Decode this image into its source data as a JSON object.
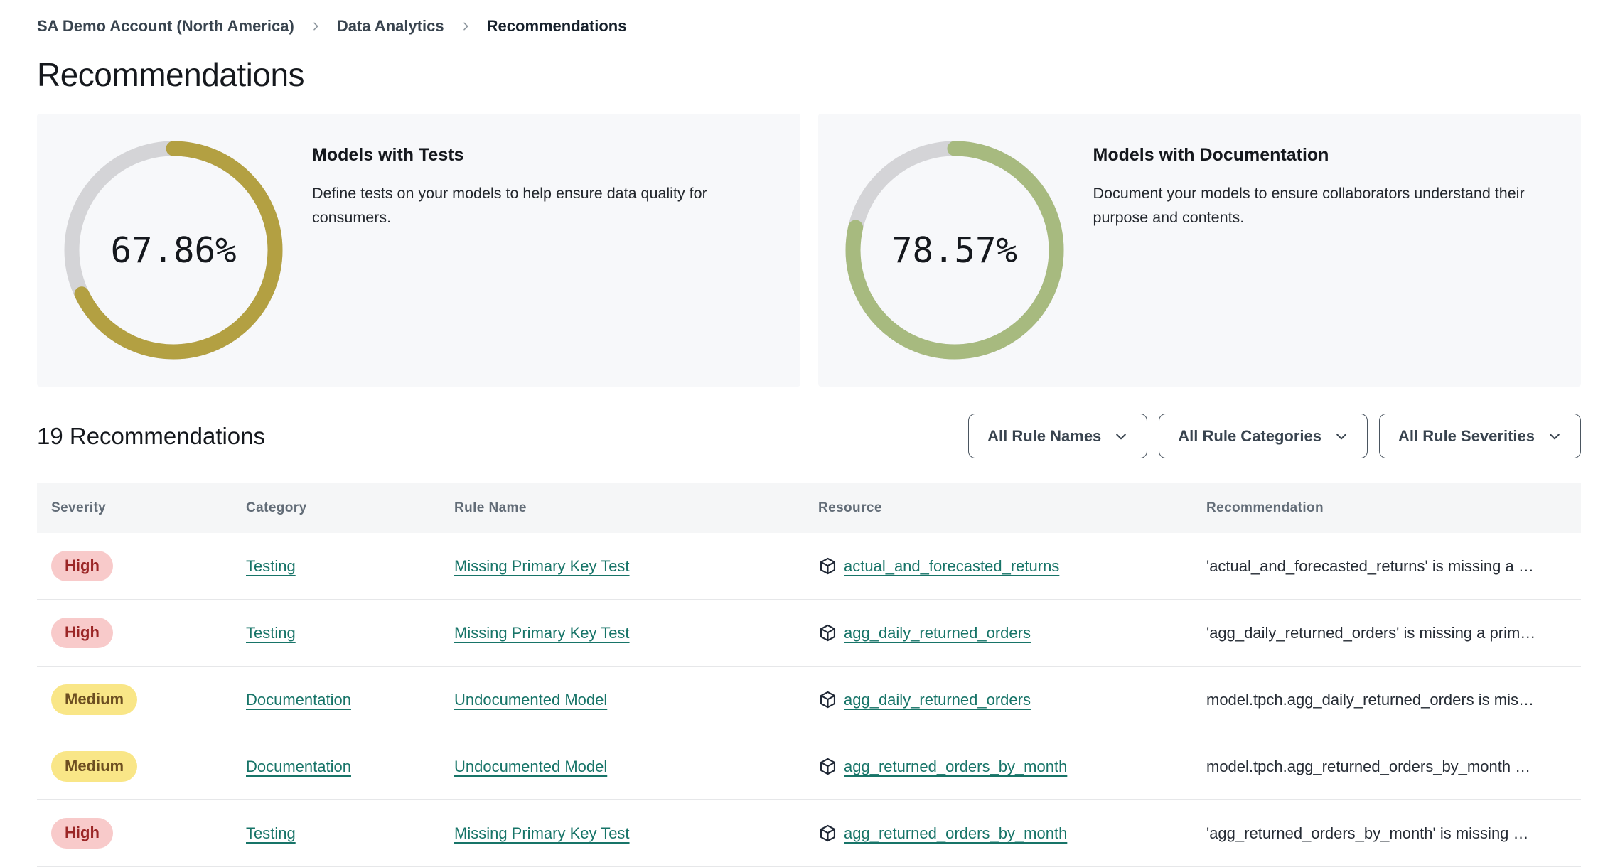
{
  "breadcrumb": {
    "items": [
      {
        "label": "SA Demo Account (North America)",
        "current": false
      },
      {
        "label": "Data Analytics",
        "current": false
      },
      {
        "label": "Recommendations",
        "current": true
      }
    ]
  },
  "page": {
    "title": "Recommendations"
  },
  "cards": [
    {
      "title": "Models with Tests",
      "description": "Define tests on your models to help ensure data quality for consumers.",
      "percent_label": "67.86%",
      "value": 67.86,
      "ring_color": "#b3a042",
      "track_color": "#d4d4d7"
    },
    {
      "title": "Models with Documentation",
      "description": "Document your models to ensure collaborators understand their purpose and contents.",
      "percent_label": "78.57%",
      "value": 78.57,
      "ring_color": "#a7ba7f",
      "track_color": "#d4d4d7"
    }
  ],
  "list_header": {
    "count_label": "19 Recommendations",
    "filters": [
      {
        "label": "All Rule Names"
      },
      {
        "label": "All Rule Categories"
      },
      {
        "label": "All Rule Severities"
      }
    ]
  },
  "table": {
    "columns": [
      "Severity",
      "Category",
      "Rule Name",
      "Resource",
      "Recommendation"
    ],
    "rows": [
      {
        "severity": "High",
        "severity_type": "high",
        "category": "Testing",
        "rule_name": "Missing Primary Key Test",
        "resource": "actual_and_forecasted_returns",
        "recommendation": "'actual_and_forecasted_returns' is missing a …"
      },
      {
        "severity": "High",
        "severity_type": "high",
        "category": "Testing",
        "rule_name": "Missing Primary Key Test",
        "resource": "agg_daily_returned_orders",
        "recommendation": "'agg_daily_returned_orders' is missing a prim…"
      },
      {
        "severity": "Medium",
        "severity_type": "medium",
        "category": "Documentation",
        "rule_name": "Undocumented Model",
        "resource": "agg_daily_returned_orders",
        "recommendation": "model.tpch.agg_daily_returned_orders is mis…"
      },
      {
        "severity": "Medium",
        "severity_type": "medium",
        "category": "Documentation",
        "rule_name": "Undocumented Model",
        "resource": "agg_returned_orders_by_month",
        "recommendation": "model.tpch.agg_returned_orders_by_month …"
      },
      {
        "severity": "High",
        "severity_type": "high",
        "category": "Testing",
        "rule_name": "Missing Primary Key Test",
        "resource": "agg_returned_orders_by_month",
        "recommendation": "'agg_returned_orders_by_month' is missing …"
      }
    ]
  },
  "colors": {
    "link_teal": "#177468",
    "high_badge_bg": "#f8caca",
    "high_badge_text": "#9b2626",
    "medium_badge_bg": "#f9e687",
    "medium_badge_text": "#6d4f21",
    "tests_ring": "#b3a042",
    "docs_ring": "#a7ba7f",
    "donut_track": "#d4d4d7",
    "table_header_bg": "#f5f6f7",
    "card_bg": "#f7f8fa"
  }
}
